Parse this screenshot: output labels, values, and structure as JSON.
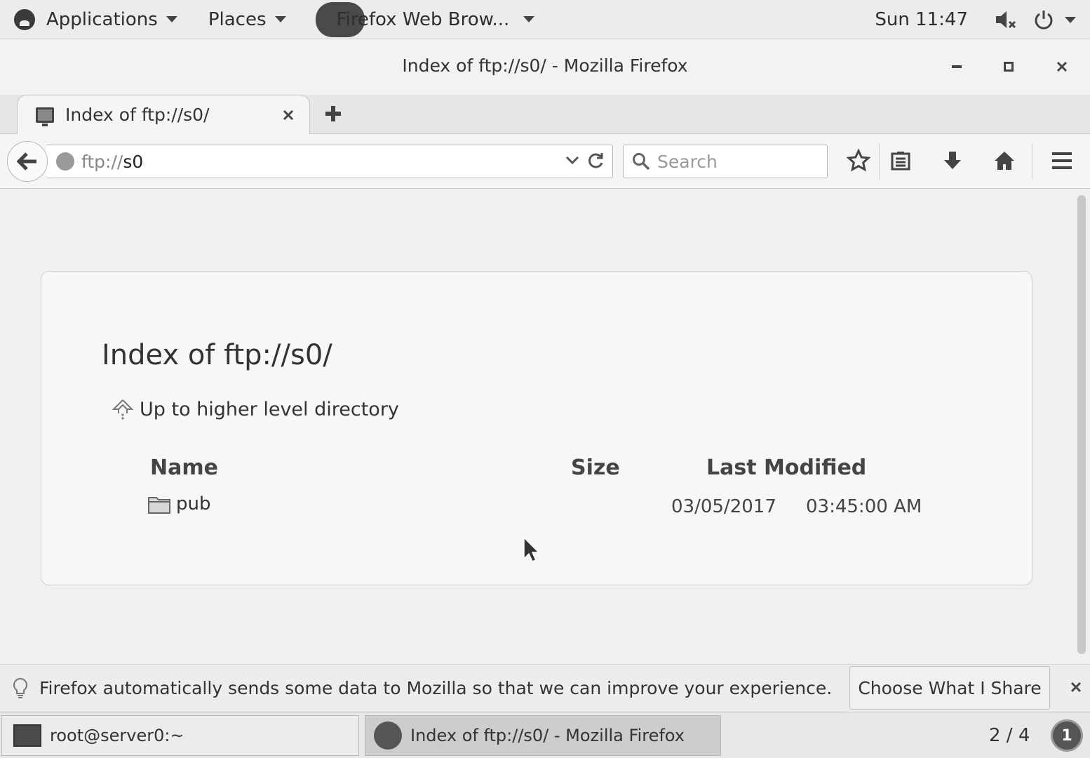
{
  "topbar": {
    "applications": "Applications",
    "places": "Places",
    "active_app": "Firefox Web Brow...",
    "clock": "Sun 11:47"
  },
  "window": {
    "title": "Index of ftp://s0/ - Mozilla Firefox"
  },
  "tabs": [
    {
      "title": "Index of ftp://s0/"
    }
  ],
  "navbar": {
    "url_scheme": "ftp://",
    "url_host": "s0",
    "search_placeholder": "Search"
  },
  "page": {
    "heading": "Index of ftp://s0/",
    "up_link": "Up to higher level directory",
    "columns": {
      "name": "Name",
      "size": "Size",
      "modified": "Last Modified"
    },
    "rows": [
      {
        "name": "pub",
        "size": "",
        "date": "03/05/2017",
        "time": "03:45:00 AM"
      }
    ]
  },
  "notification": {
    "text": "Firefox automatically sends some data to Mozilla so that we can improve your experience.",
    "button": "Choose What I Share"
  },
  "taskbar": {
    "tasks": [
      {
        "label": "root@server0:~"
      },
      {
        "label": "Index of ftp://s0/ - Mozilla Firefox"
      }
    ],
    "workspace": "2 / 4",
    "notification_count": "1"
  }
}
